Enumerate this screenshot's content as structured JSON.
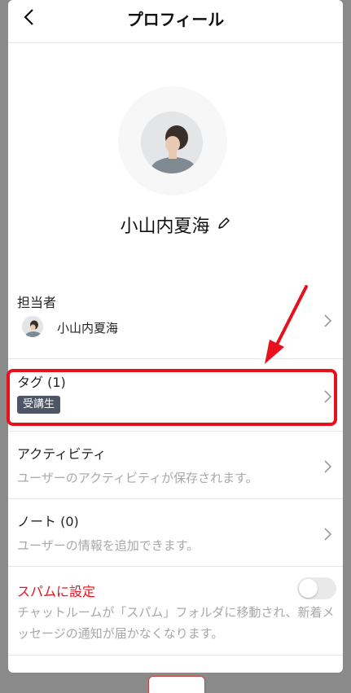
{
  "header": {
    "title": "プロフィール"
  },
  "profile": {
    "name": "小山内夏海"
  },
  "assignee": {
    "label": "担当者",
    "name": "小山内夏海"
  },
  "tags": {
    "label": "タグ (1)",
    "items": [
      "受講生"
    ]
  },
  "activity": {
    "label": "アクティビティ",
    "description": "ユーザーのアクティビティが保存されます。"
  },
  "note": {
    "label": "ノート (0)",
    "description": "ユーザーの情報を追加できます。"
  },
  "spam": {
    "label": "スパムに設定",
    "description": "チャットルームが「スパム」フォルダに移動され、新着メッセージの通知が届かなくなります。",
    "enabled": false
  },
  "colors": {
    "accent_red": "#e8101c",
    "tag_bg": "#4d5566"
  },
  "icons": {
    "back": "chevron-left-icon",
    "edit": "pencil-icon",
    "row_arrow": "chevron-right-icon",
    "annotation": "red-arrow-icon"
  }
}
